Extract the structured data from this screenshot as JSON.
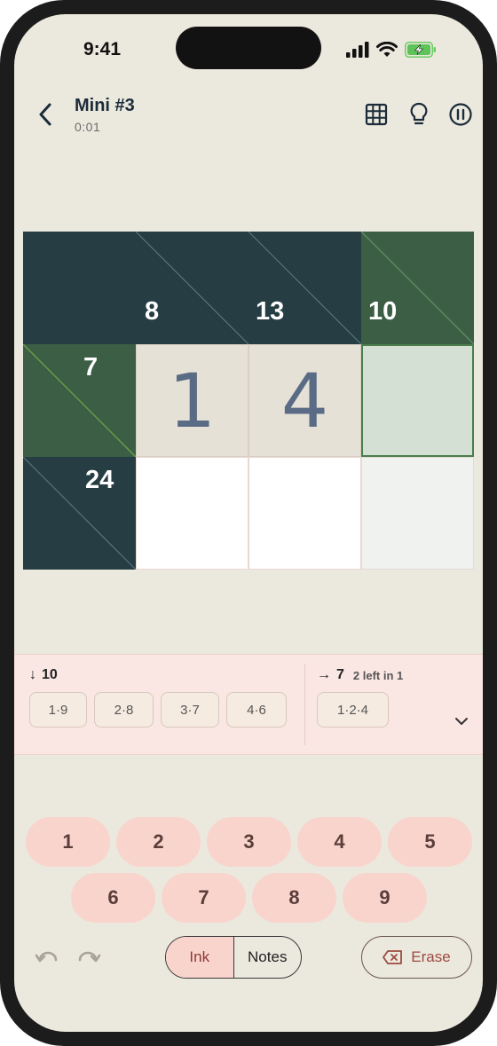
{
  "status_bar": {
    "time": "9:41"
  },
  "header": {
    "title": "Mini #3",
    "timer": "0:01"
  },
  "icons": {
    "back": "chevron-left-icon",
    "grid": "grid-icon",
    "hint": "lightbulb-icon",
    "pause": "pause-icon",
    "undo": "undo-icon",
    "redo": "redo-icon",
    "erase": "backspace-icon"
  },
  "grid": {
    "clues": {
      "c8": "8",
      "c13": "13",
      "c10": "10",
      "c7": "7",
      "c24": "24"
    },
    "values": {
      "r1c1": "1",
      "r1c2": "4",
      "r1c3": ""
    }
  },
  "combos": {
    "down": {
      "arrow": "↓",
      "sum": "10",
      "chips": [
        "1·9",
        "2·8",
        "3·7",
        "4·6"
      ]
    },
    "across": {
      "arrow": "→",
      "sum": "7",
      "subtitle": "2 left in 1",
      "chips": [
        "1·2·4"
      ]
    }
  },
  "keypad": {
    "keys": [
      "1",
      "2",
      "3",
      "4",
      "5",
      "6",
      "7",
      "8",
      "9"
    ]
  },
  "controls": {
    "ink_label": "Ink",
    "notes_label": "Notes",
    "erase_label": "Erase"
  },
  "colors": {
    "dark_cell": "#263d44",
    "green_cell": "#3b5e45",
    "key_bg": "#f9d4cd",
    "value_color": "#5a6b86",
    "selected_border": "#4a7d4c"
  }
}
